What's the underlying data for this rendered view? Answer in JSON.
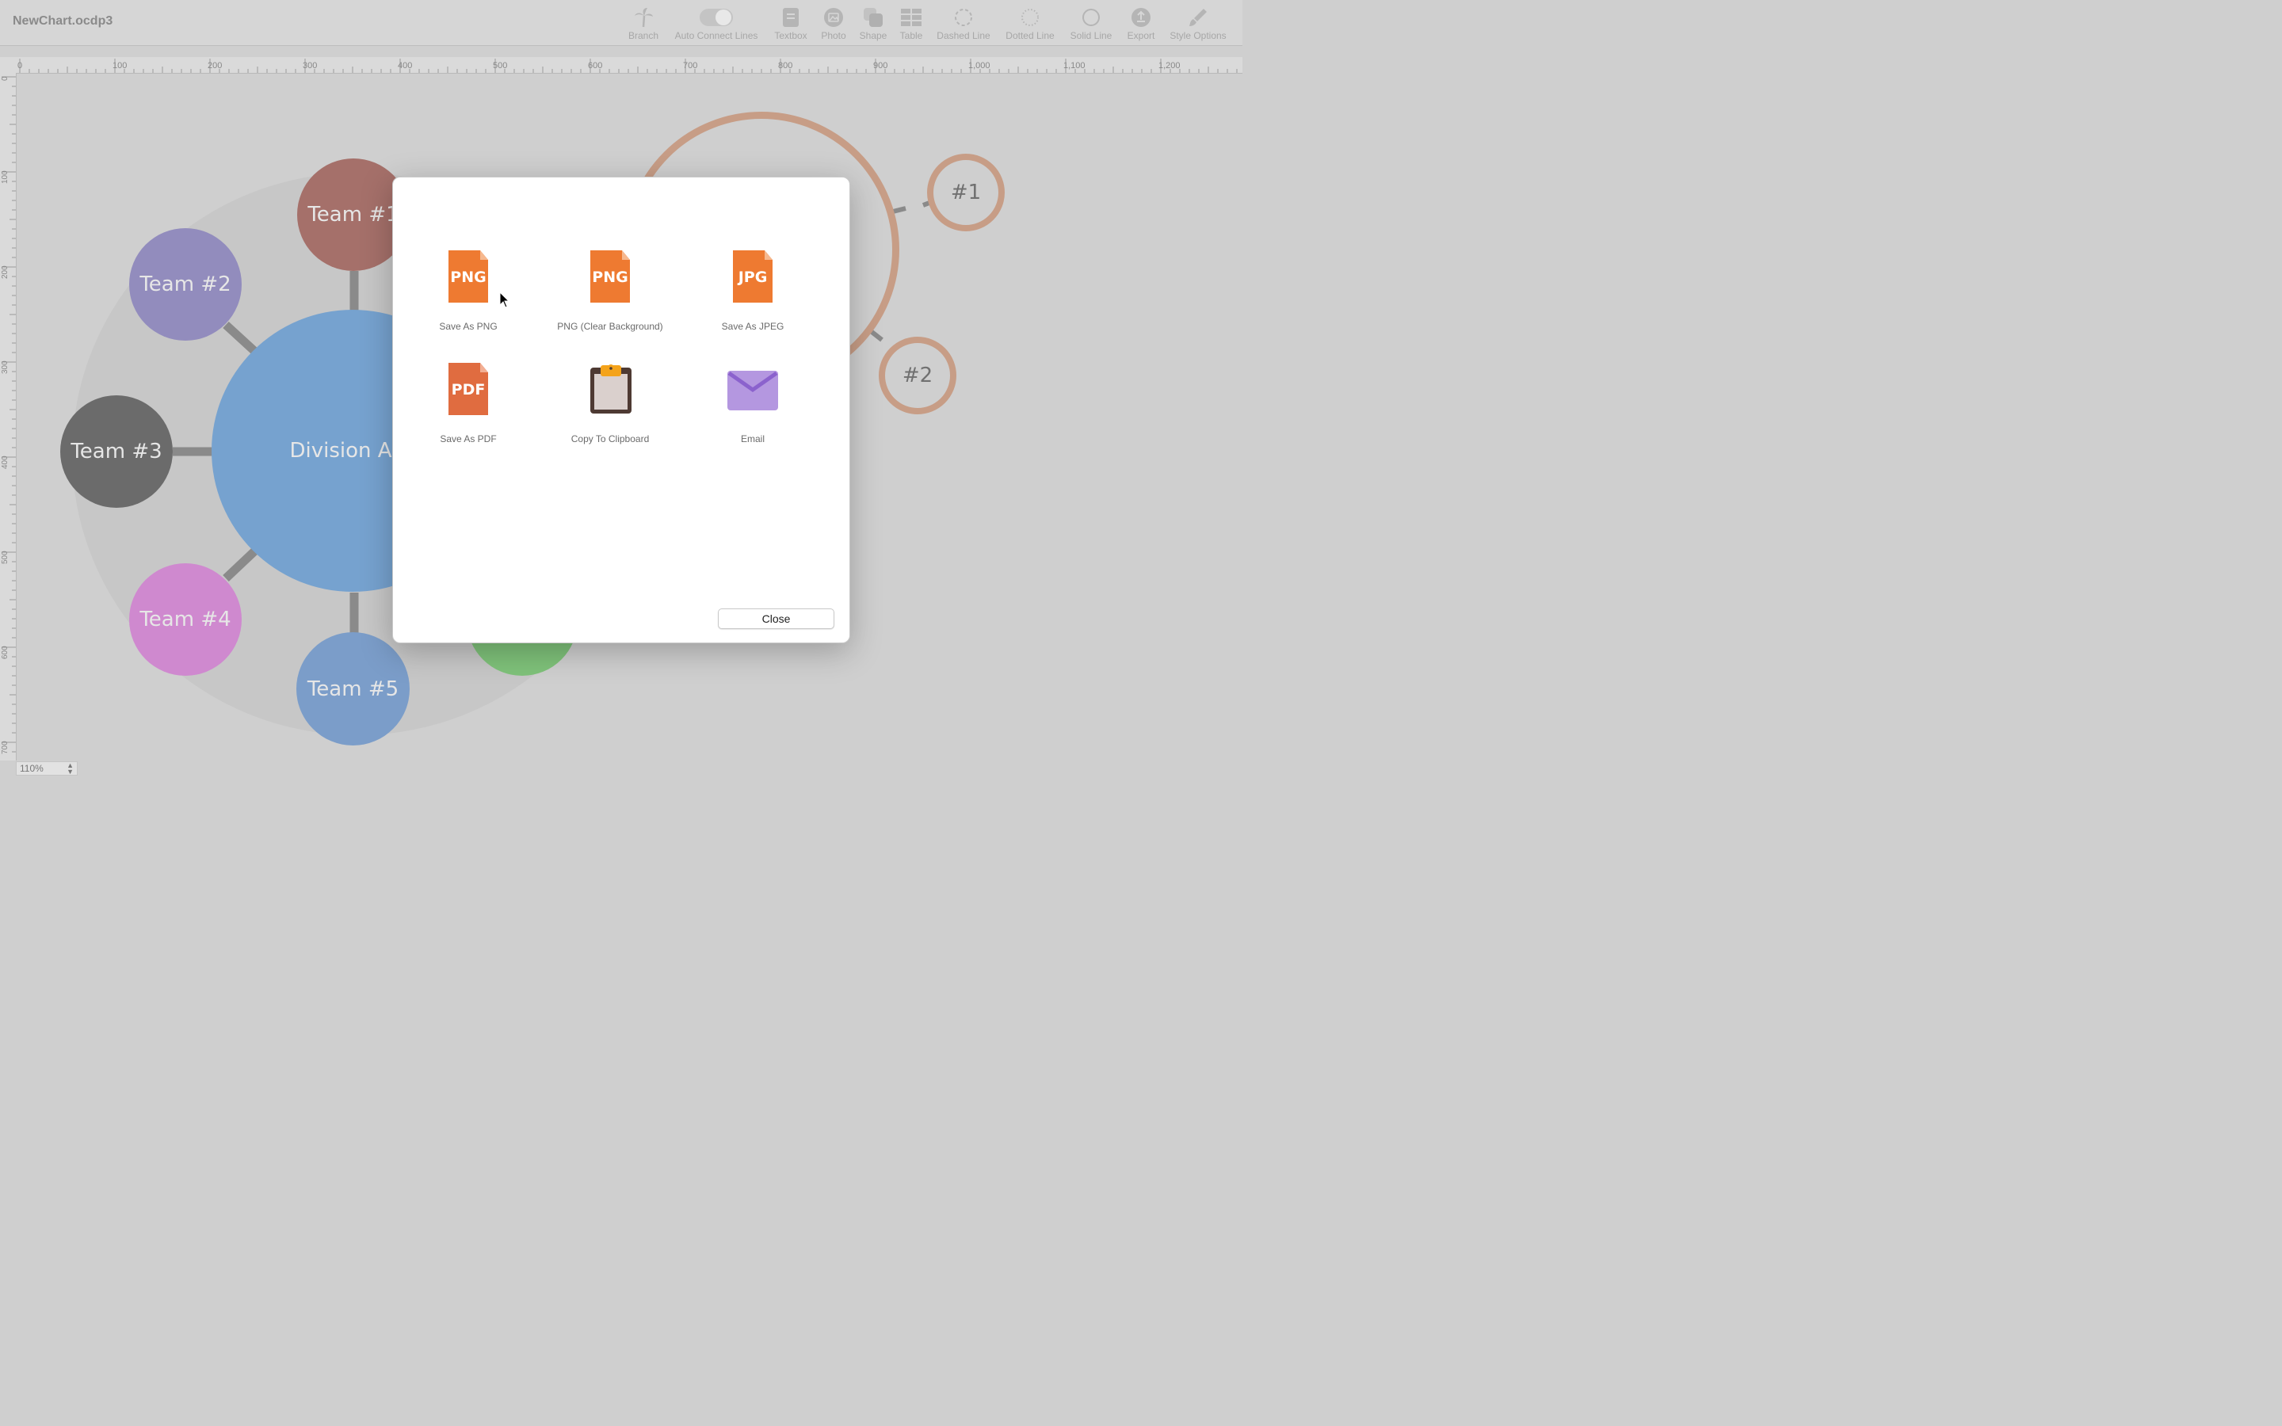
{
  "app": {
    "title": "NewChart.ocdp3"
  },
  "toolbar": {
    "items": [
      {
        "label": "Branch",
        "icon": "palm-tree-icon"
      },
      {
        "label": "Auto Connect Lines",
        "icon": "toggle-switch"
      },
      {
        "label": "Textbox",
        "icon": "textbox-icon"
      },
      {
        "label": "Photo",
        "icon": "photo-icon"
      },
      {
        "label": "Shape",
        "icon": "shape-icon"
      },
      {
        "label": "Table",
        "icon": "table-icon"
      },
      {
        "label": "Dashed Line",
        "icon": "dashed-circle-icon"
      },
      {
        "label": "Dotted Line",
        "icon": "dotted-circle-icon"
      },
      {
        "label": "Solid Line",
        "icon": "solid-circle-icon"
      },
      {
        "label": "Export",
        "icon": "export-icon"
      },
      {
        "label": "Style Options",
        "icon": "paintbrush-icon"
      }
    ]
  },
  "ruler": {
    "h_ticks": [
      "0",
      "100",
      "200",
      "300",
      "400",
      "500",
      "600",
      "700",
      "800",
      "900",
      "1,000",
      "1,100",
      "1,200"
    ],
    "v_ticks": [
      "0",
      "100",
      "200",
      "300",
      "400",
      "500",
      "600",
      "700"
    ]
  },
  "canvas": {
    "nodes": {
      "team1": "Team #1",
      "team2": "Team #2",
      "team3": "Team #3",
      "team4": "Team #4",
      "team5": "Team #5",
      "division": "Division A",
      "ring1": "#1",
      "ring2": "#2"
    },
    "colors": {
      "team1": "#a5706a",
      "team2": "#928cbd",
      "team3": "#6b6b6b",
      "team4": "#cf89cf",
      "team5": "#7b9dc9",
      "division": "#76a2cf",
      "green": "#7fc27a",
      "ring": "#c79d86"
    }
  },
  "zoom": {
    "value": "110%"
  },
  "export_dialog": {
    "options": [
      {
        "label": "Save As PNG",
        "icon_text": "PNG",
        "icon": "png-file-icon"
      },
      {
        "label": "PNG (Clear Background)",
        "icon_text": "PNG",
        "icon": "png-file-icon"
      },
      {
        "label": "Save As JPEG",
        "icon_text": "JPG",
        "icon": "jpg-file-icon"
      },
      {
        "label": "Save As PDF",
        "icon_text": "PDF",
        "icon": "pdf-file-icon"
      },
      {
        "label": "Copy To Clipboard",
        "icon": "clipboard-icon"
      },
      {
        "label": "Email",
        "icon": "envelope-icon"
      }
    ],
    "close_label": "Close"
  }
}
